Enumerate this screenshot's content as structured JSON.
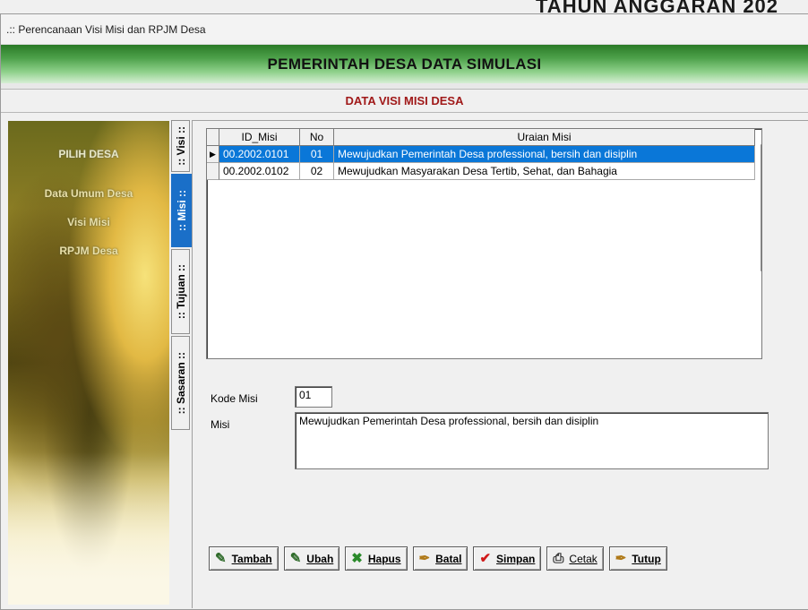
{
  "backdrop": {
    "text": "TAHUN ANGGARAN 202"
  },
  "window": {
    "title": ".:: Perencanaan Visi Misi dan RPJM Desa"
  },
  "header": {
    "banner": "PEMERINTAH DESA DATA SIMULASI",
    "subtitle": "DATA VISI MISI DESA"
  },
  "sidebar": {
    "title": "PILIH DESA",
    "items": [
      {
        "label": "Data Umum Desa"
      },
      {
        "label": "Visi Misi"
      },
      {
        "label": "RPJM Desa"
      }
    ]
  },
  "tabs": [
    {
      "label": ":: Visi ::",
      "active": false
    },
    {
      "label": ":: Misi ::",
      "active": true
    },
    {
      "label": ":: Tujuan ::",
      "active": false
    },
    {
      "label": ":: Sasaran ::",
      "active": false
    }
  ],
  "grid": {
    "columns": [
      "ID_Misi",
      "No",
      "Uraian Misi"
    ],
    "indicator": "▶",
    "rows": [
      {
        "id": "00.2002.0101",
        "no": "01",
        "uraian": "Mewujudkan Pemerintah Desa professional, bersih dan disiplin",
        "selected": true
      },
      {
        "id": "00.2002.0102",
        "no": "02",
        "uraian": "Mewujudkan Masyarakan Desa Tertib, Sehat, dan Bahagia",
        "selected": false
      }
    ]
  },
  "form": {
    "kode_label": "Kode Misi",
    "kode_value": "01",
    "misi_label": "Misi",
    "misi_value": "Mewujudkan Pemerintah Desa professional, bersih dan disiplin"
  },
  "buttons": [
    {
      "key": "tambah",
      "label": "Tambah",
      "icon": "add-icon"
    },
    {
      "key": "ubah",
      "label": "Ubah",
      "icon": "edit-icon"
    },
    {
      "key": "hapus",
      "label": "Hapus",
      "icon": "delete-icon"
    },
    {
      "key": "batal",
      "label": "Batal",
      "icon": "cancel-icon"
    },
    {
      "key": "simpan",
      "label": "Simpan",
      "icon": "check-icon"
    },
    {
      "key": "cetak",
      "label": "Cetak",
      "icon": "printer-icon"
    },
    {
      "key": "tutup",
      "label": "Tutup",
      "icon": "close-icon"
    }
  ]
}
